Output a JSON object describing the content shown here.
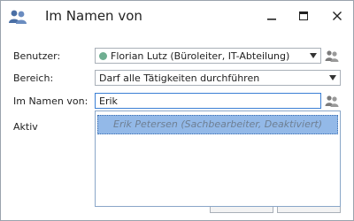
{
  "window": {
    "title": "Im Namen von",
    "icon": "users-icon",
    "controls": [
      "minimize-icon",
      "maximize-icon",
      "close-icon"
    ]
  },
  "form": {
    "user": {
      "label": "Benutzer:",
      "value": "Florian Lutz (Büroleiter, IT-Abteilung)",
      "status_color": "#6fae91"
    },
    "area": {
      "label": "Bereich:",
      "value": "Darf alle Tätigkeiten durchführen"
    },
    "on_behalf": {
      "label": "Im Namen von:",
      "value": "Erik"
    },
    "active": {
      "label": "Aktiv"
    }
  },
  "suggestions": [
    {
      "label": "Erik Petersen (Sachbearbeiter, Deaktiviert)"
    }
  ],
  "colors": {
    "accent": "#3b7fd4",
    "selection": "#93b9e8",
    "icon": "#4a6fa5"
  }
}
